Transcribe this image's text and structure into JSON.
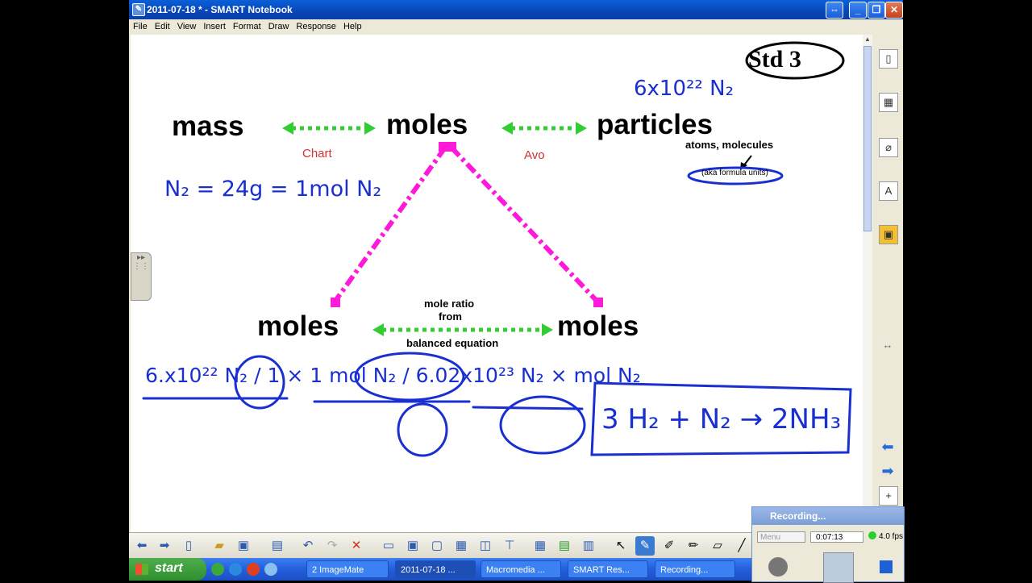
{
  "window": {
    "title": "2011-07-18 * - SMART Notebook"
  },
  "menu": [
    "File",
    "Edit",
    "View",
    "Insert",
    "Format",
    "Draw",
    "Response",
    "Help"
  ],
  "page": {
    "badge": "Std 3",
    "words": {
      "mass": "mass",
      "moles_top": "moles",
      "particles": "particles",
      "moles_left": "moles",
      "moles_right": "moles"
    },
    "labels": {
      "chart": "Chart",
      "avo": "Avo",
      "atoms_molecules": "atoms, molecules",
      "aka": "(aka formula units)",
      "mole_ratio": "mole ratio",
      "from": "from",
      "balanced": "balanced equation"
    },
    "handwriting": {
      "top_right": "6x10²² N₂",
      "left_eq": "N₂ = 24g = 1mol N₂",
      "bottom_eq": "6.x10²² N₂ / 1 × 1 mol N₂ / 6.02x10²³ N₂ × mol N₂",
      "reaction": "3 H₂ + N₂ → 2NH₃"
    },
    "colors": {
      "arrow": "#33cc33",
      "triangle": "#ff1ad9",
      "label_red": "#d43030",
      "ink": "#1a2fd0"
    }
  },
  "recorder": {
    "title": "Recording...",
    "menu": "Menu",
    "time": "0:07:13",
    "fps": "4.0 fps"
  },
  "taskbar": {
    "start": "start",
    "tasks": [
      "2 ImageMate",
      "2011-07-18 ...",
      "Macromedia ...",
      "SMART Res...",
      "Recording..."
    ]
  }
}
